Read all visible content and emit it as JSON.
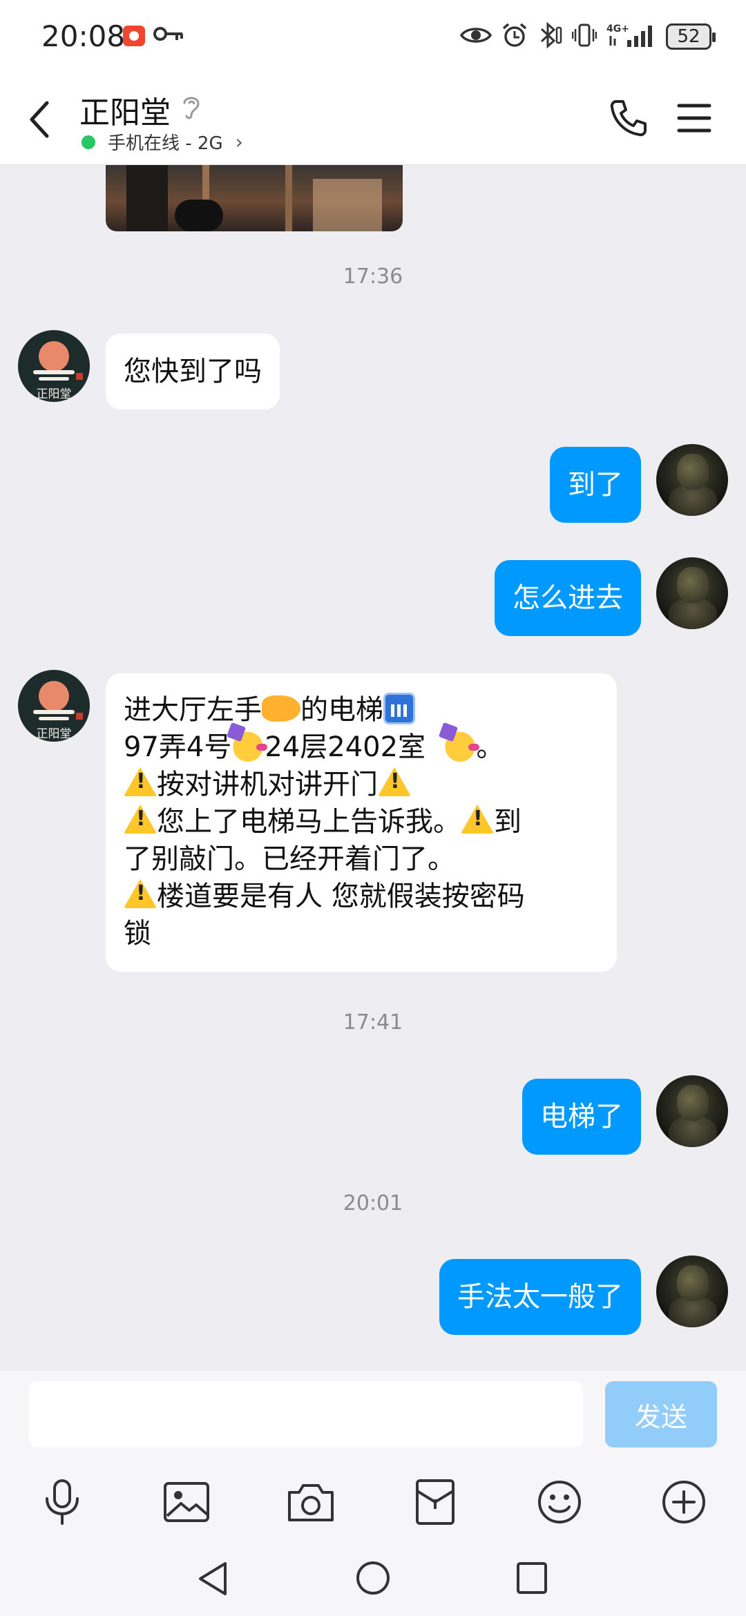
{
  "status_bar": {
    "time": "20:08",
    "network": "4G+",
    "battery": "52",
    "icons": [
      "screen-record-icon",
      "vpn-key-icon",
      "eye-icon",
      "alarm-icon",
      "bluetooth-icon",
      "vibrate-icon",
      "signal-icon",
      "battery-icon"
    ]
  },
  "header": {
    "contact_name": "正阳堂",
    "online_status": "手机在线 - 2G",
    "icons": [
      "back-arrow-icon",
      "ear-icon",
      "chevron-right-icon",
      "phone-icon",
      "menu-icon"
    ]
  },
  "messages": [
    {
      "type": "timestamp",
      "text": "17:36"
    },
    {
      "sender": "contact",
      "text": "您快到了吗"
    },
    {
      "sender": "me",
      "text": "到了"
    },
    {
      "sender": "me",
      "text": "怎么进去"
    },
    {
      "sender": "contact",
      "lines": [
        "进大厅左手",
        "的电梯",
        "97弄4号",
        "24层2402室",
        "。",
        "按对讲机对讲开门",
        "您上了电梯马上告诉我。",
        "到",
        "了别敲门。已经开着门了。",
        "楼道要是有人 您就假装按密码",
        "锁"
      ]
    },
    {
      "type": "timestamp",
      "text": "17:41"
    },
    {
      "sender": "me",
      "text": "电梯了"
    },
    {
      "type": "timestamp",
      "text": "20:01"
    },
    {
      "sender": "me",
      "text": "手法太一般了"
    }
  ],
  "input": {
    "value": "",
    "send_label": "发送"
  },
  "toolbar": [
    "microphone-icon",
    "image-icon",
    "camera-icon",
    "red-packet-icon",
    "emoji-icon",
    "plus-icon"
  ],
  "navigation": [
    "nav-back-icon",
    "nav-home-icon",
    "nav-recents-icon"
  ],
  "colors": {
    "outgoing_bubble": "#0099ff",
    "incoming_bubble": "#ffffff",
    "chat_background": "#ededf2",
    "send_button_disabled": "#92cdfa",
    "online_dot": "#25c864"
  }
}
